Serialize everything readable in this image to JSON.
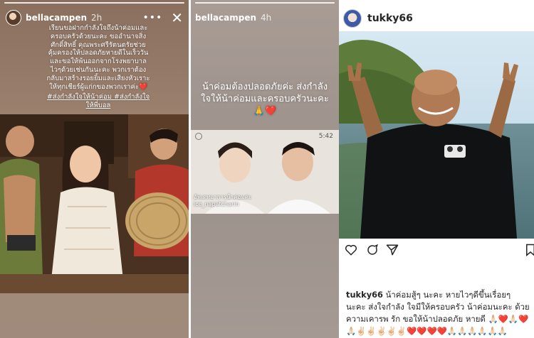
{
  "panel1": {
    "username": "bellacampen",
    "time": "2h",
    "caption": "เรียนขอฝากกำลังใจถึงน้าค่อมและครอบครัวด้วยนะคะ ขออำนาจสิ่งศักดิ์สิทธิ์ คุณพระศรีรัตนตรัยช่วยคุ้มครองให้ปลอดภัยหายดีในเร็ววัน และขอให้พ้นออกจากโรงพยาบาลไวๆด้วยเช่นกันนะคะ พวกเราต้องกลับมาสร้างรอยยิ้มและเสียงหัวเราะให้ทุกเชียร์ผู้แก่กของพวกเราค่ะ❤️",
    "hashtags": "#ส่งกำลังใจให้น้าค่อม #ส่งกำลังใจให้พี่บอล",
    "more_icon": "more-dots-icon",
    "close_icon": "close-icon"
  },
  "panel2": {
    "username": "bellacampen",
    "time": "4h",
    "title_text": "น้าค่อมต้องปลอดภัยค่ะ ส่งกำลังใจให้น้าค่อมและครอบครัวนะคะ 🙏",
    "heart": "❤️",
    "video_duration": "5:42",
    "post_overlay_text": "อัพเดทอาการน้าค่อมค่ะ",
    "post_user": "ice_napatcharin"
  },
  "panel3": {
    "username": "tukky66",
    "caption_user": "tukky66",
    "caption_text": " น้าค่อมสู้ๆ นะคะ หายไวๆดีขึ้นเรื่อยๆ นะคะ ส่งใจกำลัง ใจมีให้ครอบครัว น้าค่อมนะคะ ด้วยความเคารพ รัก ขอให้น้าปลอดภัย หายดี 🙏🏻❤️🙏🏻❤️🙏🏻✌🏻✌🏻✌🏻✌🏻✌🏻❤️❤️❤️❤️🙏🏻🙏🏻🙏🏻🙏🏻🙏🏻🙏🏻",
    "actions": [
      "heart-icon",
      "comment-icon",
      "share-icon",
      "save-icon"
    ]
  }
}
